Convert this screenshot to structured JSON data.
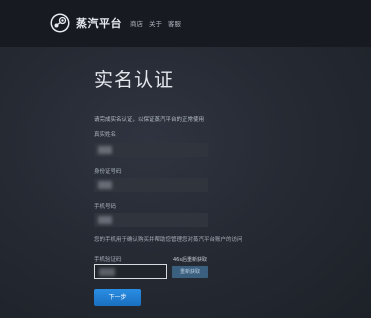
{
  "header": {
    "logo_text": "蒸汽平台",
    "nav": [
      "商店",
      "关于",
      "客服"
    ]
  },
  "page": {
    "title": "实名认证",
    "intro": "请完成实名认证，以保证蒸汽平台的正常使用"
  },
  "form": {
    "name_label": "真实姓名",
    "id_label": "身份证号码",
    "phone_label": "手机号码",
    "phone_note": "您的手机用于确认购买并帮助您管理您对蒸汽平台账户的访问",
    "code_label": "手机验证码",
    "resend_countdown": "46s后重新获取",
    "resend_button": "重新获取",
    "next_button": "下一步"
  },
  "colors": {
    "topbar": "#171a21",
    "background": "#262a33",
    "primary_button": "#1e7fd6",
    "secondary_button": "#3b5f7e"
  }
}
